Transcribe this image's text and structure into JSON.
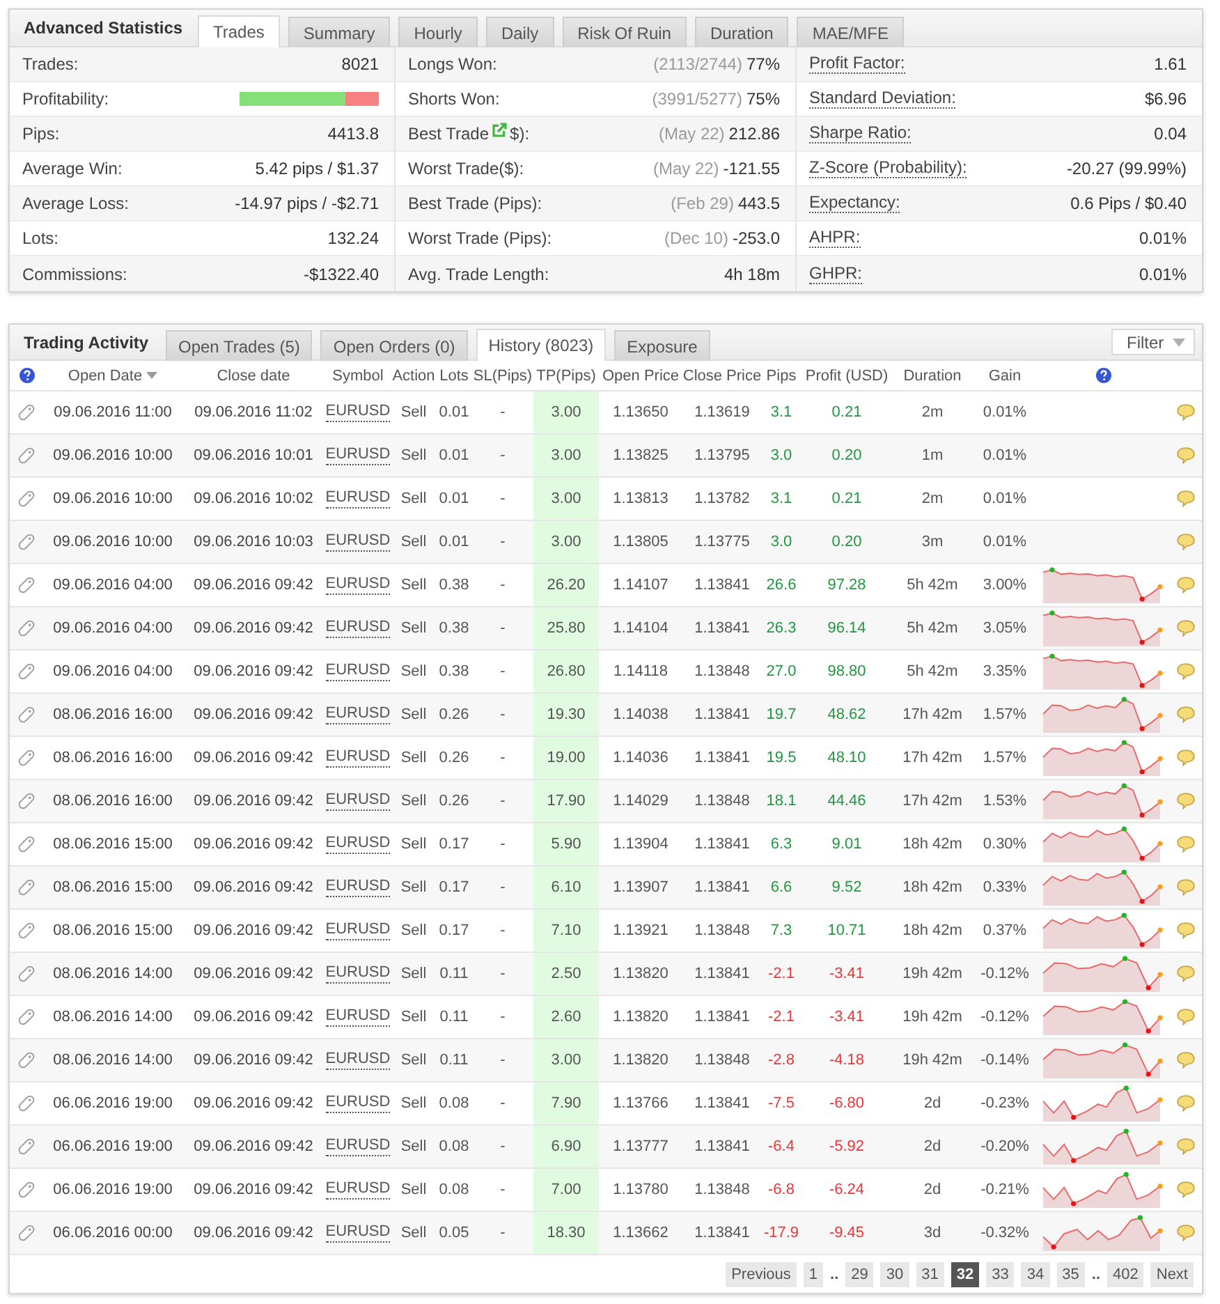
{
  "stats": {
    "title": "Advanced Statistics",
    "tabs": [
      {
        "label": "Trades",
        "selected": true
      },
      {
        "label": "Summary",
        "selected": false
      },
      {
        "label": "Hourly",
        "selected": false
      },
      {
        "label": "Daily",
        "selected": false
      },
      {
        "label": "Risk Of Ruin",
        "selected": false
      },
      {
        "label": "Duration",
        "selected": false
      },
      {
        "label": "MAE/MFE",
        "selected": false
      }
    ],
    "columns": [
      {
        "rows": [
          {
            "kind": "text",
            "label": "Trades:",
            "value": "8021"
          },
          {
            "kind": "bar",
            "label": "Profitability:",
            "level": 0.76
          },
          {
            "kind": "text",
            "label": "Pips:",
            "value": "4413.8"
          },
          {
            "kind": "text",
            "label": "Average Win:",
            "value": "5.42 pips / $1.37"
          },
          {
            "kind": "text",
            "label": "Average Loss:",
            "value": "-14.97 pips / -$2.71"
          },
          {
            "kind": "text",
            "label": "Lots:",
            "value": "132.24"
          },
          {
            "kind": "text",
            "label": "Commissions:",
            "value": "-$1322.40"
          }
        ]
      },
      {
        "rows": [
          {
            "kind": "text",
            "label": "Longs Won:",
            "note": "(2113/2744)",
            "value": "77%"
          },
          {
            "kind": "text",
            "label": "Shorts Won:",
            "note": "(3991/5277)",
            "value": "75%"
          },
          {
            "kind": "icon",
            "label": "Best Trade",
            "label_end": "$):",
            "note": "(May 22)",
            "value": "212.86"
          },
          {
            "kind": "text",
            "label": "Worst Trade($):",
            "note": "(May 22)",
            "value": "-121.55"
          },
          {
            "kind": "text",
            "label": "Best Trade (Pips):",
            "note": "(Feb 29)",
            "value": "443.5"
          },
          {
            "kind": "text",
            "label": "Worst Trade (Pips):",
            "note": "(Dec 10)",
            "value": "-253.0"
          },
          {
            "kind": "text",
            "label": "Avg. Trade Length:",
            "value": "4h 18m"
          }
        ]
      },
      {
        "rows": [
          {
            "kind": "hint",
            "label": "Profit Factor:",
            "value": "1.61"
          },
          {
            "kind": "hint",
            "label": "Standard Deviation:",
            "value": "$6.96"
          },
          {
            "kind": "hint",
            "label": "Sharpe Ratio:",
            "value": "0.04"
          },
          {
            "kind": "hint",
            "label": "Z-Score (Probability):",
            "value": "-20.27 (99.99%)"
          },
          {
            "kind": "hint",
            "label": "Expectancy:",
            "value": "0.6 Pips / $0.40"
          },
          {
            "kind": "hint",
            "label": "AHPR:",
            "value": "0.01%"
          },
          {
            "kind": "hint",
            "label": "GHPR:",
            "value": "0.01%"
          }
        ]
      }
    ]
  },
  "activity": {
    "title": "Trading Activity",
    "tabs": [
      {
        "label": "Open Trades (5)",
        "selected": false
      },
      {
        "label": "Open Orders (0)",
        "selected": false
      },
      {
        "label": "History (8023)",
        "selected": true
      },
      {
        "label": "Exposure",
        "selected": false
      }
    ],
    "filter": "Filter",
    "table": {
      "columns": [
        {
          "label": "Open Date",
          "sorted": true
        },
        {
          "label": "Close date",
          "sorted": false
        },
        {
          "label": "Symbol",
          "sorted": false
        },
        {
          "label": "Action",
          "sorted": false
        },
        {
          "label": "Lots",
          "sorted": false
        },
        {
          "label": "SL(Pips)",
          "sorted": false
        },
        {
          "label": "TP(Pips)",
          "sorted": false
        },
        {
          "label": "Open Price",
          "sorted": false
        },
        {
          "label": "Close Price",
          "sorted": false
        },
        {
          "label": "Pips",
          "sorted": false
        },
        {
          "label": "Profit (USD)",
          "sorted": false
        },
        {
          "label": "Duration",
          "sorted": false
        },
        {
          "label": "Gain",
          "sorted": false
        }
      ],
      "rows": [
        {
          "kind": "win",
          "open_date": "09.06.2016 11:00",
          "close_date": "09.06.2016 11:02",
          "symbol": "EURUSD",
          "action": "Sell",
          "lots": "0.01",
          "sl": "-",
          "tp": "3.00",
          "open_price": "1.13650",
          "close_price": "1.13619",
          "pips": "3.1",
          "profit": "0.21",
          "duration": "2m",
          "gain": "0.01%",
          "sparkline": false
        },
        {
          "kind": "win",
          "open_date": "09.06.2016 10:00",
          "close_date": "09.06.2016 10:01",
          "symbol": "EURUSD",
          "action": "Sell",
          "lots": "0.01",
          "sl": "-",
          "tp": "3.00",
          "open_price": "1.13825",
          "close_price": "1.13795",
          "pips": "3.0",
          "profit": "0.20",
          "duration": "1m",
          "gain": "0.01%",
          "sparkline": false
        },
        {
          "kind": "win",
          "open_date": "09.06.2016 10:00",
          "close_date": "09.06.2016 10:02",
          "symbol": "EURUSD",
          "action": "Sell",
          "lots": "0.01",
          "sl": "-",
          "tp": "3.00",
          "open_price": "1.13813",
          "close_price": "1.13782",
          "pips": "3.1",
          "profit": "0.21",
          "duration": "2m",
          "gain": "0.01%",
          "sparkline": false
        },
        {
          "kind": "win",
          "open_date": "09.06.2016 10:00",
          "close_date": "09.06.2016 10:03",
          "symbol": "EURUSD",
          "action": "Sell",
          "lots": "0.01",
          "sl": "-",
          "tp": "3.00",
          "open_price": "1.13805",
          "close_price": "1.13775",
          "pips": "3.0",
          "profit": "0.20",
          "duration": "3m",
          "gain": "0.01%",
          "sparkline": false
        },
        {
          "kind": "win",
          "open_date": "09.06.2016 04:00",
          "close_date": "09.06.2016 09:42",
          "symbol": "EURUSD",
          "action": "Sell",
          "lots": "0.38",
          "sl": "-",
          "tp": "26.20",
          "open_price": "1.14107",
          "close_price": "1.13841",
          "pips": "26.6",
          "profit": "97.28",
          "duration": "5h 42m",
          "gain": "3.00%",
          "sparkline": true
        },
        {
          "kind": "win",
          "open_date": "09.06.2016 04:00",
          "close_date": "09.06.2016 09:42",
          "symbol": "EURUSD",
          "action": "Sell",
          "lots": "0.38",
          "sl": "-",
          "tp": "25.80",
          "open_price": "1.14104",
          "close_price": "1.13841",
          "pips": "26.3",
          "profit": "96.14",
          "duration": "5h 42m",
          "gain": "3.05%",
          "sparkline": true
        },
        {
          "kind": "win",
          "open_date": "09.06.2016 04:00",
          "close_date": "09.06.2016 09:42",
          "symbol": "EURUSD",
          "action": "Sell",
          "lots": "0.38",
          "sl": "-",
          "tp": "26.80",
          "open_price": "1.14118",
          "close_price": "1.13848",
          "pips": "27.0",
          "profit": "98.80",
          "duration": "5h 42m",
          "gain": "3.35%",
          "sparkline": true
        },
        {
          "kind": "win",
          "open_date": "08.06.2016 16:00",
          "close_date": "09.06.2016 09:42",
          "symbol": "EURUSD",
          "action": "Sell",
          "lots": "0.26",
          "sl": "-",
          "tp": "19.30",
          "open_price": "1.14038",
          "close_price": "1.13841",
          "pips": "19.7",
          "profit": "48.62",
          "duration": "17h 42m",
          "gain": "1.57%",
          "sparkline": true
        },
        {
          "kind": "win",
          "open_date": "08.06.2016 16:00",
          "close_date": "09.06.2016 09:42",
          "symbol": "EURUSD",
          "action": "Sell",
          "lots": "0.26",
          "sl": "-",
          "tp": "19.00",
          "open_price": "1.14036",
          "close_price": "1.13841",
          "pips": "19.5",
          "profit": "48.10",
          "duration": "17h 42m",
          "gain": "1.57%",
          "sparkline": true
        },
        {
          "kind": "win",
          "open_date": "08.06.2016 16:00",
          "close_date": "09.06.2016 09:42",
          "symbol": "EURUSD",
          "action": "Sell",
          "lots": "0.26",
          "sl": "-",
          "tp": "17.90",
          "open_price": "1.14029",
          "close_price": "1.13848",
          "pips": "18.1",
          "profit": "44.46",
          "duration": "17h 42m",
          "gain": "1.53%",
          "sparkline": true
        },
        {
          "kind": "win",
          "open_date": "08.06.2016 15:00",
          "close_date": "09.06.2016 09:42",
          "symbol": "EURUSD",
          "action": "Sell",
          "lots": "0.17",
          "sl": "-",
          "tp": "5.90",
          "open_price": "1.13904",
          "close_price": "1.13841",
          "pips": "6.3",
          "profit": "9.01",
          "duration": "18h 42m",
          "gain": "0.30%",
          "sparkline": true
        },
        {
          "kind": "win",
          "open_date": "08.06.2016 15:00",
          "close_date": "09.06.2016 09:42",
          "symbol": "EURUSD",
          "action": "Sell",
          "lots": "0.17",
          "sl": "-",
          "tp": "6.10",
          "open_price": "1.13907",
          "close_price": "1.13841",
          "pips": "6.6",
          "profit": "9.52",
          "duration": "18h 42m",
          "gain": "0.33%",
          "sparkline": true
        },
        {
          "kind": "win",
          "open_date": "08.06.2016 15:00",
          "close_date": "09.06.2016 09:42",
          "symbol": "EURUSD",
          "action": "Sell",
          "lots": "0.17",
          "sl": "-",
          "tp": "7.10",
          "open_price": "1.13921",
          "close_price": "1.13848",
          "pips": "7.3",
          "profit": "10.71",
          "duration": "18h 42m",
          "gain": "0.37%",
          "sparkline": true
        },
        {
          "kind": "loss",
          "open_date": "08.06.2016 14:00",
          "close_date": "09.06.2016 09:42",
          "symbol": "EURUSD",
          "action": "Sell",
          "lots": "0.11",
          "sl": "-",
          "tp": "2.50",
          "open_price": "1.13820",
          "close_price": "1.13841",
          "pips": "-2.1",
          "profit": "-3.41",
          "duration": "19h 42m",
          "gain": "-0.12%",
          "sparkline": true
        },
        {
          "kind": "loss",
          "open_date": "08.06.2016 14:00",
          "close_date": "09.06.2016 09:42",
          "symbol": "EURUSD",
          "action": "Sell",
          "lots": "0.11",
          "sl": "-",
          "tp": "2.60",
          "open_price": "1.13820",
          "close_price": "1.13841",
          "pips": "-2.1",
          "profit": "-3.41",
          "duration": "19h 42m",
          "gain": "-0.12%",
          "sparkline": true
        },
        {
          "kind": "loss",
          "open_date": "08.06.2016 14:00",
          "close_date": "09.06.2016 09:42",
          "symbol": "EURUSD",
          "action": "Sell",
          "lots": "0.11",
          "sl": "-",
          "tp": "3.00",
          "open_price": "1.13820",
          "close_price": "1.13848",
          "pips": "-2.8",
          "profit": "-4.18",
          "duration": "19h 42m",
          "gain": "-0.14%",
          "sparkline": true
        },
        {
          "kind": "loss",
          "open_date": "06.06.2016 19:00",
          "close_date": "09.06.2016 09:42",
          "symbol": "EURUSD",
          "action": "Sell",
          "lots": "0.08",
          "sl": "-",
          "tp": "7.90",
          "open_price": "1.13766",
          "close_price": "1.13841",
          "pips": "-7.5",
          "profit": "-6.80",
          "duration": "2d",
          "gain": "-0.23%",
          "sparkline": true
        },
        {
          "kind": "loss",
          "open_date": "06.06.2016 19:00",
          "close_date": "09.06.2016 09:42",
          "symbol": "EURUSD",
          "action": "Sell",
          "lots": "0.08",
          "sl": "-",
          "tp": "6.90",
          "open_price": "1.13777",
          "close_price": "1.13841",
          "pips": "-6.4",
          "profit": "-5.92",
          "duration": "2d",
          "gain": "-0.20%",
          "sparkline": true
        },
        {
          "kind": "loss",
          "open_date": "06.06.2016 19:00",
          "close_date": "09.06.2016 09:42",
          "symbol": "EURUSD",
          "action": "Sell",
          "lots": "0.08",
          "sl": "-",
          "tp": "7.00",
          "open_price": "1.13780",
          "close_price": "1.13848",
          "pips": "-6.8",
          "profit": "-6.24",
          "duration": "2d",
          "gain": "-0.21%",
          "sparkline": true
        },
        {
          "kind": "loss",
          "open_date": "06.06.2016 00:00",
          "close_date": "09.06.2016 09:42",
          "symbol": "EURUSD",
          "action": "Sell",
          "lots": "0.05",
          "sl": "-",
          "tp": "18.30",
          "open_price": "1.13662",
          "close_price": "1.13841",
          "pips": "-17.9",
          "profit": "-9.45",
          "duration": "3d",
          "gain": "-0.32%",
          "sparkline": true
        }
      ]
    },
    "pagination": {
      "previous": "Previous",
      "pages": [
        {
          "label": "1",
          "selected": false
        },
        {
          "label": "29",
          "selected": false,
          "gap_before": ".."
        },
        {
          "label": "30",
          "selected": false
        },
        {
          "label": "31",
          "selected": false
        },
        {
          "label": "32",
          "selected": true
        },
        {
          "label": "33",
          "selected": false
        },
        {
          "label": "34",
          "selected": false
        },
        {
          "label": "35",
          "selected": false
        },
        {
          "label": "402",
          "selected": false,
          "gap_before": ".."
        }
      ],
      "next": "Next"
    }
  }
}
